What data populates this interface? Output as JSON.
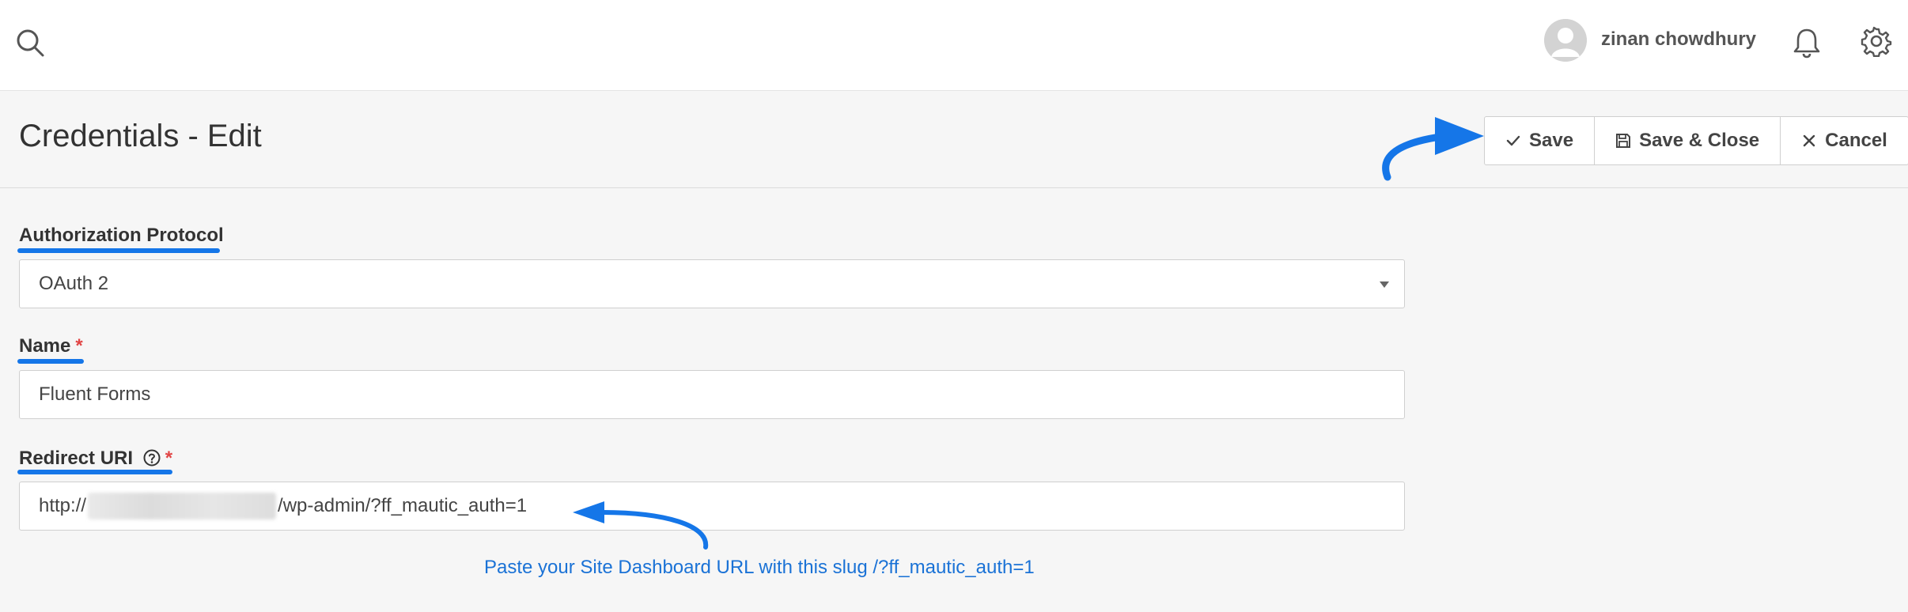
{
  "topbar": {
    "user_name": "zinan chowdhury",
    "icons": [
      "search-icon",
      "avatar",
      "bell-icon",
      "gear-icon"
    ]
  },
  "header": {
    "title": "Credentials - Edit",
    "buttons": {
      "save": "Save",
      "save_close": "Save & Close",
      "cancel": "Cancel"
    }
  },
  "form": {
    "auth_protocol": {
      "label": "Authorization Protocol",
      "value": "OAuth 2"
    },
    "name": {
      "label": "Name",
      "required_mark": "*",
      "value": "Fluent Forms"
    },
    "redirect_uri": {
      "label": "Redirect URI",
      "required_mark": "*",
      "value_prefix": "http://",
      "value_suffix": "/wp-admin/?ff_mautic_auth=1"
    }
  },
  "annotation": {
    "note": "Paste your Site Dashboard URL with this slug /?ff_mautic_auth=1"
  },
  "colors": {
    "accent": "#1576e8",
    "required": "#e14545",
    "note_text": "#1a72d6"
  }
}
